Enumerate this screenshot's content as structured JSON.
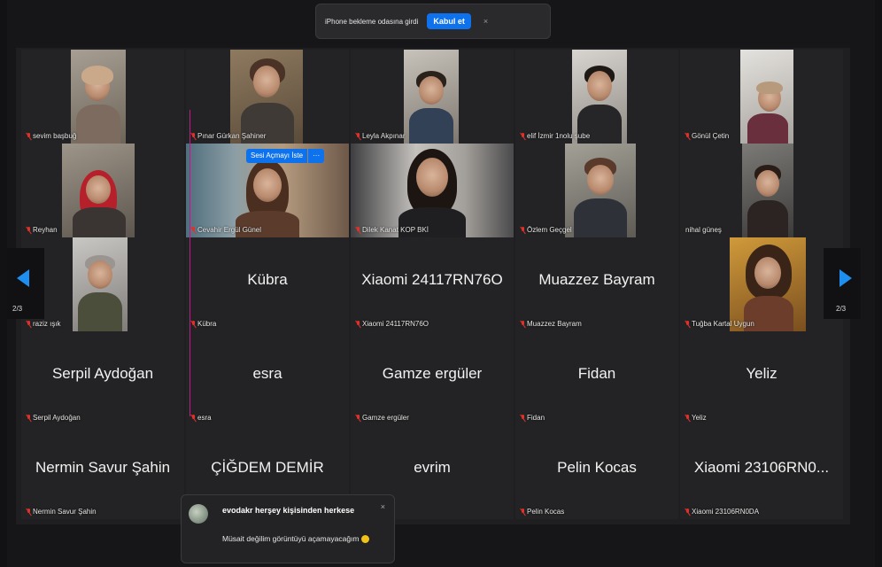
{
  "colors": {
    "accent": "#0e72ed",
    "mic_muted": "#e0312a",
    "highlight_line": "#c01a8a",
    "bg": "#161618"
  },
  "waiting_room": {
    "message": "iPhone bekleme odasına girdi",
    "accept_label": "Kabul et",
    "close_glyph": "×"
  },
  "pagination": {
    "left_page": "2/3",
    "right_page": "2/3"
  },
  "ask_to_unmute": {
    "label": "Sesi Açmayı İste",
    "more": "···"
  },
  "participants": [
    {
      "label": "sevim başbuğ",
      "video": true
    },
    {
      "label": "Pınar Gürkan Şahiner",
      "video": true
    },
    {
      "label": "Leyla Akpınar",
      "video": true
    },
    {
      "label": "elif İzmir 1nolu şube",
      "video": true
    },
    {
      "label": "Gönül Çetin",
      "video": true
    },
    {
      "label": "Reyhan",
      "video": true
    },
    {
      "label": "Cevahir Ergül Günel",
      "video": true
    },
    {
      "label": "Dilek Kanat KOP BKİ",
      "video": true
    },
    {
      "label": "Özlem Geçgel",
      "video": true
    },
    {
      "label": "nihal güneş",
      "video": true
    },
    {
      "label": "raziz ışık",
      "video": true
    },
    {
      "label": "Kübra",
      "name": "Kübra",
      "video": false
    },
    {
      "label": "Xiaomi 24117RN76O",
      "name": "Xiaomi 24117RN76O",
      "video": false
    },
    {
      "label": "Muazzez Bayram",
      "name": "Muazzez Bayram",
      "video": false
    },
    {
      "label": "Tuğba Kartal Uygun",
      "video": true
    },
    {
      "label": "Serpil Aydoğan",
      "name": "Serpil Aydoğan",
      "video": false
    },
    {
      "label": "esra",
      "name": "esra",
      "video": false
    },
    {
      "label": "Gamze ergüler",
      "name": "Gamze ergüler",
      "video": false
    },
    {
      "label": "Fidan",
      "name": "Fidan",
      "video": false
    },
    {
      "label": "Yeliz",
      "name": "Yeliz",
      "video": false
    },
    {
      "label": "Nermin Savur Şahin",
      "name": "Nermin Savur Şahin",
      "video": false
    },
    {
      "label": "",
      "name": "ÇİĞDEM DEMİR",
      "video": false
    },
    {
      "label": "",
      "name": "evrim",
      "video": false
    },
    {
      "label": "Pelin Kocas",
      "name": "Pelin Kocas",
      "video": false
    },
    {
      "label": "Xiaomi 23106RN0DA",
      "name": "Xiaomi 23106RN0...",
      "video": false
    }
  ],
  "chat": {
    "sender": "evodakr herşey kişisinden herkese",
    "message": "Müsait değilim görüntüyü açamayacağım",
    "close_glyph": "×"
  }
}
